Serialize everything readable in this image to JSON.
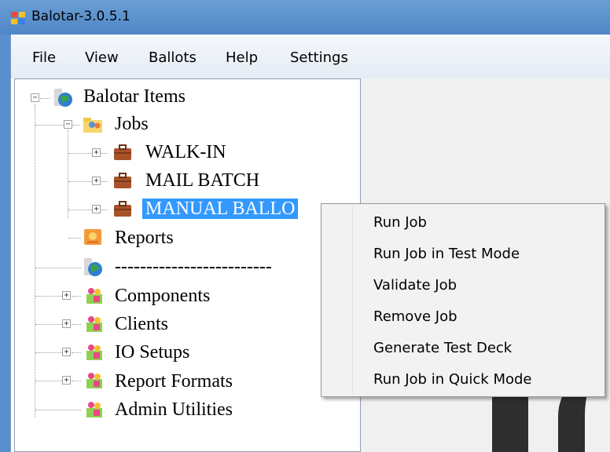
{
  "window": {
    "title": "Balotar-3.0.5.1"
  },
  "menubar": {
    "items": [
      "File",
      "View",
      "Ballots",
      "Help",
      "Settings"
    ]
  },
  "tree": {
    "root": "Balotar Items",
    "jobs": "Jobs",
    "job_items": [
      "WALK-IN",
      "MAIL BATCH",
      "MANUAL BALLOTS"
    ],
    "selected_job_visible": "MANUAL BALLO",
    "reports": "Reports",
    "separator": "-------------------------",
    "groups": [
      "Components",
      "Clients",
      "IO Setups",
      "Report Formats",
      "Admin Utilities"
    ]
  },
  "context_menu": {
    "items": [
      "Run Job",
      "Run Job in Test Mode",
      "Validate Job",
      "Remove Job",
      "Generate Test Deck",
      "Run Job in Quick Mode"
    ]
  },
  "colors": {
    "selection": "#3399ff",
    "titlebar": "#4f86c6"
  },
  "icons": {
    "app": "app-icon",
    "root": "globe-person-icon",
    "jobs": "folder-people-icon",
    "job": "briefcase-icon",
    "reports": "report-icon",
    "group": "people-icon"
  }
}
